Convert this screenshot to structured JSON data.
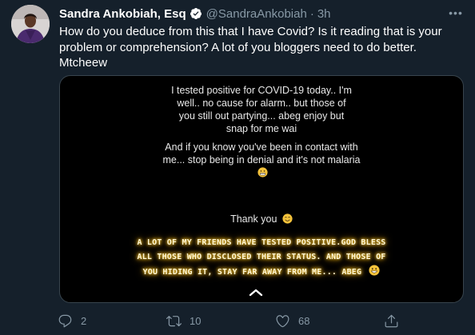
{
  "tweet": {
    "author": {
      "display_name": "Sandra Ankobiah, Esq",
      "handle": "@SandraAnkobiah",
      "separator": "·",
      "time": "3h"
    },
    "more_label": "•••",
    "text": "How do you deduce from this that I have Covid? Is it reading that is your problem or comprehension? A lot of you bloggers need to do better. Mtcheew",
    "media": {
      "paragraph_1": "I tested positive for COVID-19 today.. I'm well.. no cause for alarm.. but those of you still out partying... abeg enjoy but snap for me wai",
      "paragraph_2": "And if you know you've been in contact with me... stop being in denial and it's not malaria",
      "thanks": "Thank you",
      "glow_lines": [
        "A lot of my friends have tested positive.God bless",
        "all those who disclosed their status. And those of",
        "you hiding it, stay far away from me... abeg"
      ]
    },
    "actions": {
      "replies": "2",
      "retweets": "10",
      "likes": "68"
    }
  },
  "colors": {
    "background": "#15202b",
    "secondary_text": "#8899a6",
    "verified": "#1da1f2",
    "glow": "#f4c430"
  },
  "icons": [
    "verified-badge-icon",
    "more-icon",
    "reply-icon",
    "retweet-icon",
    "like-icon",
    "share-icon",
    "chevron-up-icon"
  ]
}
